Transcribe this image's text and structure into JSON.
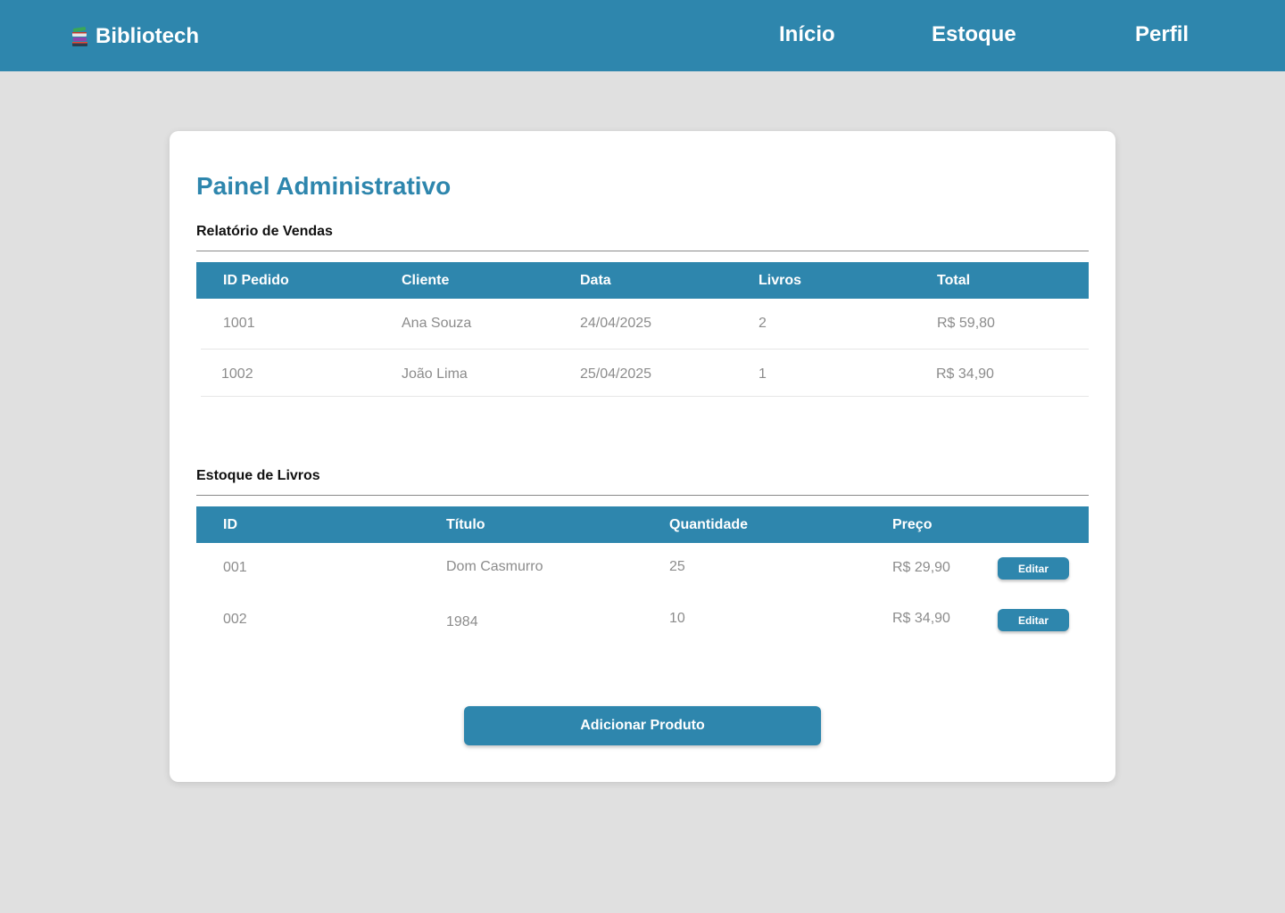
{
  "header": {
    "brand_icon": "books-icon",
    "brand": "Bibliotech",
    "nav": {
      "inicio": "Início",
      "estoque": "Estoque",
      "perfil": "Perfil"
    }
  },
  "colors": {
    "primary": "#2e86ad",
    "background": "#e0e0e0",
    "card": "#ffffff",
    "muted_text": "#8c8c8c"
  },
  "page": {
    "title": "Painel Administrativo"
  },
  "sales": {
    "title": "Relatório de Vendas",
    "columns": [
      "ID Pedido",
      "Cliente",
      "Data",
      "Livros",
      "Total"
    ],
    "rows": [
      [
        "1001",
        "Ana Souza",
        "24/04/2025",
        "2",
        "R$ 59,80"
      ],
      [
        "1002",
        "João Lima",
        "25/04/2025",
        "1",
        "R$ 34,90"
      ]
    ]
  },
  "stock": {
    "title": "Estoque de Livros",
    "columns": [
      "ID",
      "Título",
      "Quantidade",
      "Preço"
    ],
    "edit_label": "Editar",
    "rows": [
      [
        "001",
        "Dom Casmurro",
        "25",
        "R$ 29,90"
      ],
      [
        "002",
        "1984",
        "10",
        "R$ 34,90"
      ]
    ]
  },
  "actions": {
    "add_product": "Adicionar Produto"
  }
}
